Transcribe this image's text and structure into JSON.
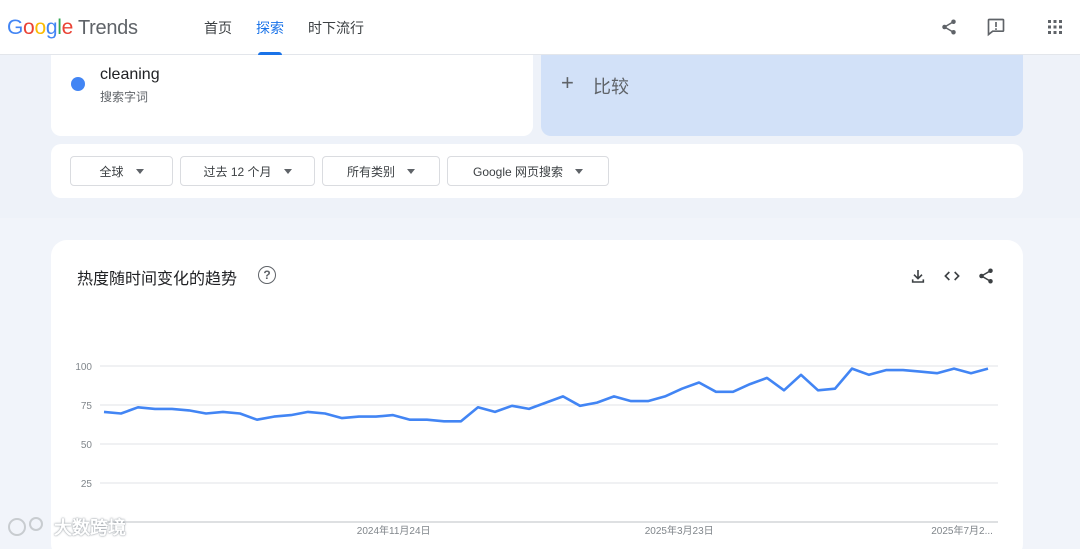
{
  "app": {
    "logo_text": "Google",
    "product": "Trends"
  },
  "nav": {
    "items": [
      {
        "label": "首页",
        "active": false
      },
      {
        "label": "探索",
        "active": true
      },
      {
        "label": "时下流行",
        "active": false
      }
    ]
  },
  "topbar_icons": [
    "share-icon",
    "feedback-icon",
    "apps-grid-icon"
  ],
  "search_term": {
    "name": "cleaning",
    "subtitle": "搜索字词",
    "color": "#4285f4"
  },
  "compare": {
    "label": "比较"
  },
  "filters": [
    {
      "label": "全球"
    },
    {
      "label": "过去 12 个月"
    },
    {
      "label": "所有类别"
    },
    {
      "label": "Google 网页搜索"
    }
  ],
  "chart_card": {
    "title": "热度随时间变化的趋势",
    "help_icon": "?",
    "icons": [
      "download-icon",
      "embed-icon",
      "share-icon"
    ]
  },
  "chart_data": {
    "type": "line",
    "title": "",
    "xlabel": "",
    "ylabel": "",
    "ylim": [
      0,
      100
    ],
    "yticks": [
      25,
      50,
      75,
      100
    ],
    "ytick_labels": [
      "25",
      "50",
      "75",
      "100"
    ],
    "grid": true,
    "color": "#4285f4",
    "x_tick_labels": [
      "2024年11月24日",
      "2025年3月23日",
      "2025年7月2..."
    ],
    "values": [
      71,
      70,
      74,
      73,
      73,
      72,
      70,
      71,
      70,
      66,
      68,
      69,
      71,
      70,
      67,
      68,
      68,
      69,
      66,
      66,
      65,
      65,
      74,
      71,
      75,
      73,
      77,
      81,
      75,
      77,
      81,
      78,
      78,
      81,
      86,
      90,
      84,
      84,
      89,
      93,
      85,
      95,
      85,
      86,
      99,
      95,
      98,
      98,
      97,
      96,
      99,
      96,
      99
    ]
  },
  "watermark": {
    "text": "大数跨境"
  }
}
